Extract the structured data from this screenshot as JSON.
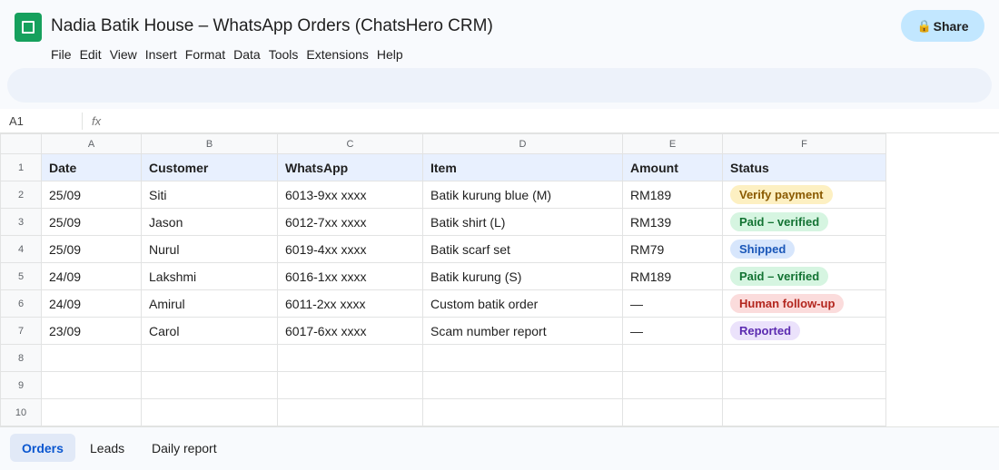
{
  "title": "Nadia Batik House – WhatsApp Orders (ChatsHero CRM)",
  "menu": [
    "File",
    "Edit",
    "View",
    "Insert",
    "Format",
    "Data",
    "Tools",
    "Extensions",
    "Help"
  ],
  "share": {
    "label": "Share",
    "icon": "lock-icon"
  },
  "formula_bar": {
    "cell_ref": "A1",
    "fx": "fx",
    "content": ""
  },
  "columns": [
    "A",
    "B",
    "C",
    "D",
    "E",
    "F"
  ],
  "header_row": {
    "num": "1",
    "cells": [
      "Date",
      "Customer",
      "WhatsApp",
      "Item",
      "Amount",
      "Status"
    ]
  },
  "rows": [
    {
      "num": "2",
      "date": "25/09",
      "customer": "Siti",
      "whatsapp": "6013-9xx xxxx",
      "item": "Batik kurung blue (M)",
      "amount": "RM189",
      "status": "Verify payment",
      "status_type": "verify"
    },
    {
      "num": "3",
      "date": "25/09",
      "customer": "Jason",
      "whatsapp": "6012-7xx xxxx",
      "item": "Batik shirt (L)",
      "amount": "RM139",
      "status": "Paid – verified",
      "status_type": "paid"
    },
    {
      "num": "4",
      "date": "25/09",
      "customer": "Nurul",
      "whatsapp": "6019-4xx xxxx",
      "item": "Batik scarf set",
      "amount": "RM79",
      "status": "Shipped",
      "status_type": "shipped"
    },
    {
      "num": "5",
      "date": "24/09",
      "customer": "Lakshmi",
      "whatsapp": "6016-1xx xxxx",
      "item": "Batik kurung (S)",
      "amount": "RM189",
      "status": "Paid – verified",
      "status_type": "paid"
    },
    {
      "num": "6",
      "date": "24/09",
      "customer": "Amirul",
      "whatsapp": "6011-2xx xxxx",
      "item": "Custom batik order",
      "amount": "—",
      "status": "Human follow-up",
      "status_type": "human"
    },
    {
      "num": "7",
      "date": "23/09",
      "customer": "Carol",
      "whatsapp": "6017-6xx xxxx",
      "item": "Scam number report",
      "amount": "—",
      "status": "Reported",
      "status_type": "reported"
    }
  ],
  "empty_rows": [
    "8",
    "9",
    "10"
  ],
  "sheet_tabs": [
    {
      "label": "Orders",
      "active": true
    },
    {
      "label": "Leads",
      "active": false
    },
    {
      "label": "Daily report",
      "active": false
    }
  ],
  "colors": {
    "brand_green": "#16a05d",
    "share_bg": "#c2e7ff",
    "header_row_bg": "#e8f0fe",
    "verify": "#fdf0c2",
    "paid": "#d6f5e1",
    "shipped": "#d7e6fc",
    "human": "#fbdcdc",
    "reported": "#ebe2fb"
  }
}
